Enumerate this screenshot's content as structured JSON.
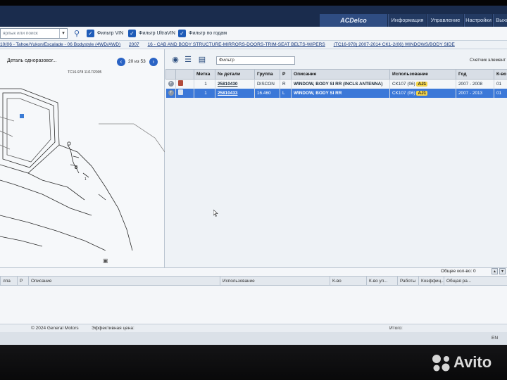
{
  "header": {
    "brand": "ACDelco",
    "nav": [
      "Информация",
      "Управление",
      "Настройки",
      "Выход"
    ]
  },
  "filters": {
    "search_placeholder": "ярлык или поиск",
    "vin_label": "Фильтр VIN",
    "ultravin_label": "Фильтр UltraVIN",
    "year_label": "Фильтр по годам"
  },
  "breadcrumb": [
    "10(06 - Tahoe/Yukon/Escalade - 06 Bodystyle (4WD/AWD)",
    "2007",
    "16 - CAB AND BODY STRUCTURE-MIRRORS-DOORS-TRIM-SEAT BELTS-WIPERS",
    "(TC16-978)  2007-2014  CK1-2(06)  WINDOWS/BODY SIDE"
  ],
  "left": {
    "detail_title": "Деталь одноразовог...",
    "page_counter": "20 из 53",
    "diagram_label": "TC16-978  11/17/2005"
  },
  "right": {
    "filter_value": "Фильтр",
    "counter_label": "Счетчик элемент",
    "columns": [
      "",
      "",
      "Метка",
      "№ детали",
      "Группа",
      "P",
      "Описание",
      "Использование",
      "Год",
      "К-во"
    ],
    "rows": [
      {
        "label": "1",
        "part_no": "25810430",
        "group": "DISCON",
        "p": "R",
        "description": "WINDOW, BODY SI RR (INCLS ANTENNA)",
        "usage": "CK107 (06)",
        "usage_chip": "AJ1",
        "year": "2007 - 2008",
        "qty": "01",
        "selected": false
      },
      {
        "label": "1",
        "part_no": "25810433",
        "group": "16.460",
        "p": "L",
        "description": "WINDOW, BODY SI RR",
        "usage": "CK107 (06)",
        "usage_chip": "AJ1",
        "year": "2007 - 2013",
        "qty": "01",
        "selected": true
      }
    ]
  },
  "bottom": {
    "total_qty": "Общее кол-во: 0",
    "columns": [
      "лпа",
      "P",
      "Описание",
      "Использование",
      "К-во",
      "К-во уп...",
      "Работы",
      "Коэффиц...",
      "Общая ра..."
    ]
  },
  "footer": {
    "copyright": "© 2024 General Motors",
    "price_label": "Эффективная цена:",
    "total_label": "Итого:",
    "lang": "EN"
  },
  "watermark": {
    "text": "Avito"
  }
}
